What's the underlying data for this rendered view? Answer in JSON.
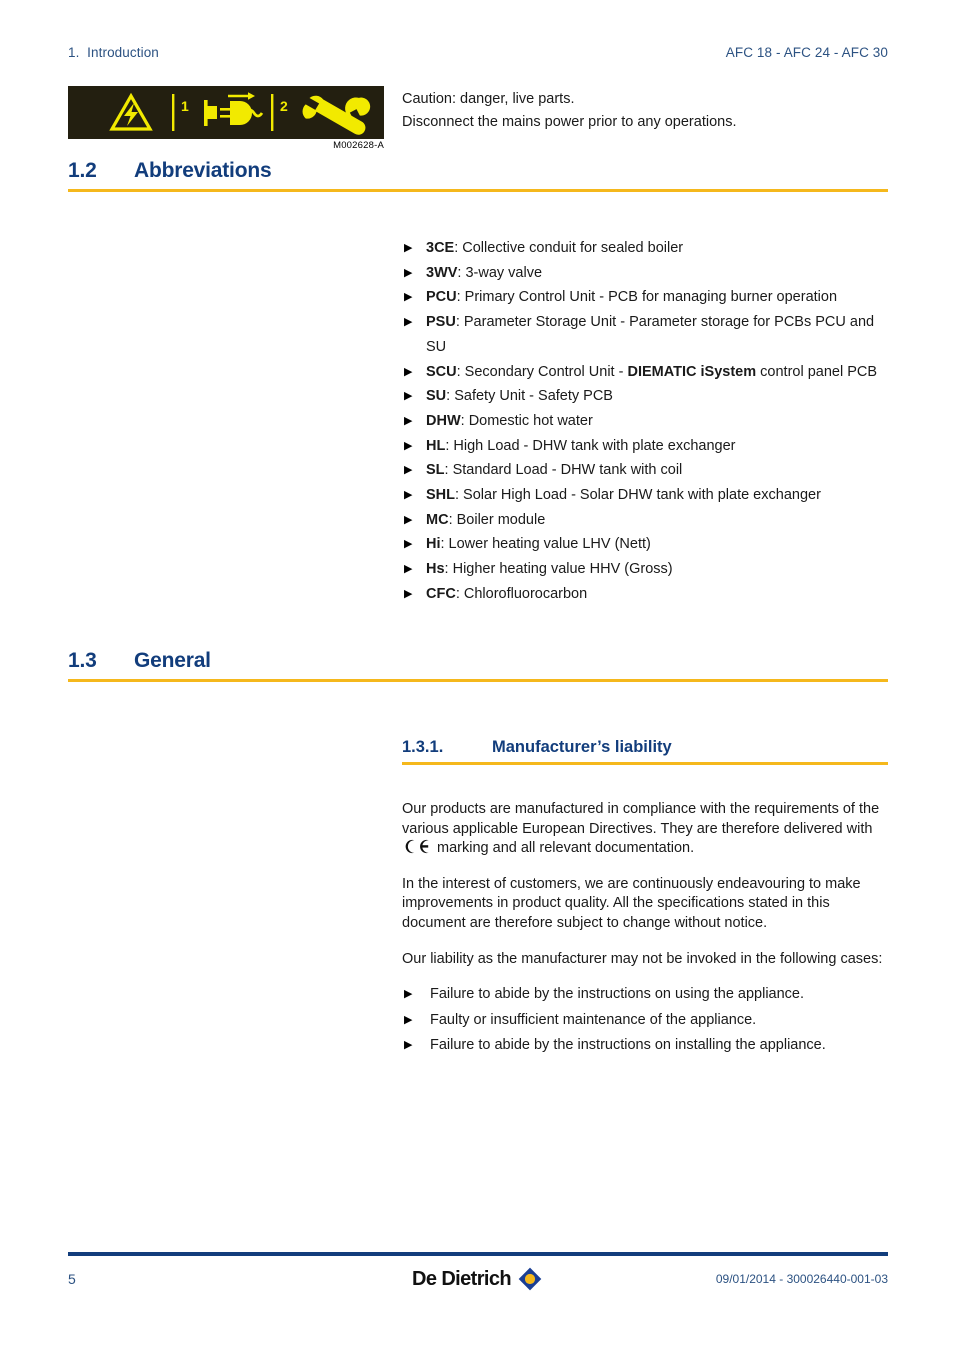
{
  "header": {
    "left": "1.  Introduction",
    "right": "AFC 18 - AFC 24 - AFC 30"
  },
  "warning": {
    "caption": "M002628-A",
    "badge_1": "1",
    "badge_2": "2",
    "line1": "Caution: danger, live parts.",
    "line2": "Disconnect the mains power prior to any operations."
  },
  "section_abbreviations": {
    "number": "1.2",
    "title": "Abbreviations",
    "items": [
      {
        "term": "3CE",
        "rest": ": Collective conduit for sealed boiler"
      },
      {
        "term": "3WV",
        "rest": ": 3-way valve"
      },
      {
        "term": "PCU",
        "rest": ": Primary Control Unit - PCB for managing burner operation"
      },
      {
        "term": "PSU",
        "rest": ": Parameter Storage Unit - Parameter storage for PCBs PCU and SU"
      },
      {
        "term": "SCU",
        "rest": ": Secondary Control Unit - ",
        "emph": "DIEMATIC iSystem",
        "tail": " control panel PCB"
      },
      {
        "term": "SU",
        "rest": ": Safety Unit - Safety PCB"
      },
      {
        "term": "DHW",
        "rest": ": Domestic hot water"
      },
      {
        "term": "HL",
        "rest": ": High Load - DHW tank with plate exchanger"
      },
      {
        "term": "SL",
        "rest": ": Standard Load - DHW tank with coil"
      },
      {
        "term": "SHL",
        "rest": ": Solar High Load - Solar DHW tank with plate exchanger"
      },
      {
        "term": "MC",
        "rest": ": Boiler module"
      },
      {
        "term": "Hi",
        "rest": ": Lower heating value LHV (Nett)"
      },
      {
        "term": "Hs",
        "rest": ": Higher heating value HHV (Gross)"
      },
      {
        "term": "CFC",
        "rest": ": Chlorofluorocarbon"
      }
    ]
  },
  "section_general": {
    "number": "1.3",
    "title": "General"
  },
  "subsection_liability": {
    "number": "1.3.1.",
    "title": "Manufacturer’s liability",
    "para1_before": "Our products are manufactured in compliance with the requirements of the various applicable European Directives. They are therefore delivered with ",
    "para1_after": " marking and all relevant documentation.",
    "para2": "In the interest of customers, we are continuously endeavouring to make improvements in product quality. All the specifications stated in this document are therefore subject to change without notice.",
    "para3": "Our liability as the manufacturer may not be invoked in the following cases:",
    "bullets": [
      "Failure to abide by the instructions on using the appliance.",
      "Faulty or insufficient maintenance of the appliance.",
      "Failure to abide by the instructions on installing the appliance."
    ]
  },
  "footer": {
    "page_number": "5",
    "logo_text": "De Dietrich",
    "reference": "09/01/2014 - 300026440-001-03"
  },
  "colors": {
    "heading_blue": "#123d7c",
    "rule_yellow": "#f5b81c",
    "header_blue": "#2c5282",
    "icon_bg": "#231f10",
    "icon_yellow": "#f2ea00",
    "logo_blue": "#1b3f94",
    "logo_dot": "#f5b81c"
  }
}
